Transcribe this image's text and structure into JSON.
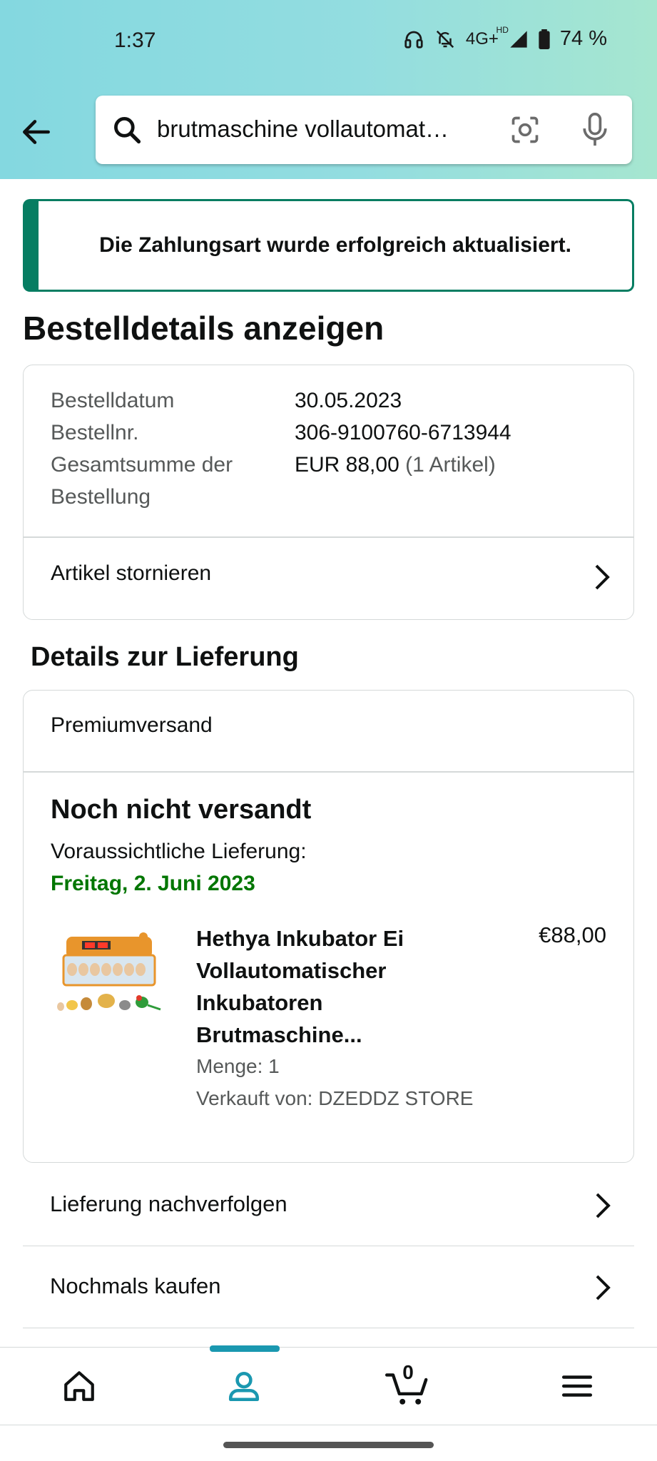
{
  "status_bar": {
    "time": "1:37",
    "network": "4G+",
    "network_badge": "HD",
    "battery": "74 %"
  },
  "search": {
    "query": "brutmaschine vollautomat…"
  },
  "alert": {
    "message": "Die Zahlungsart wurde erfolgreich aktualisiert."
  },
  "page_title": "Bestelldetails anzeigen",
  "order": {
    "date_label": "Bestelldatum",
    "date_value": "30.05.2023",
    "number_label": "Bestellnr.",
    "number_value": "306-9100760-6713944",
    "total_label_line1": "Gesamtsumme der",
    "total_label_line2": "Bestellung",
    "total_value": "EUR 88,00",
    "total_items": "(1 Artikel)",
    "cancel_label": "Artikel stornieren"
  },
  "delivery": {
    "section_title": "Details zur Lieferung",
    "shipping_method": "Premiumversand",
    "status": "Noch nicht versandt",
    "expected_label": "Voraussichtliche Lieferung:",
    "expected_date": "Freitag, 2. Juni 2023",
    "product": {
      "title": "Hethya Inkubator Ei Vollautomatischer Inkubatoren Brutmaschine...",
      "price": "€88,00",
      "quantity": "Menge: 1",
      "seller": "Verkauft von: DZEDDZ STORE"
    }
  },
  "actions": {
    "track": "Lieferung nachverfolgen",
    "buy_again": "Nochmals kaufen"
  },
  "bottom_nav": {
    "cart_count": "0",
    "active_tab": "account"
  },
  "colors": {
    "accent_green": "#067d62",
    "delivery_green": "#007600",
    "nav_active": "#1a98b0"
  }
}
